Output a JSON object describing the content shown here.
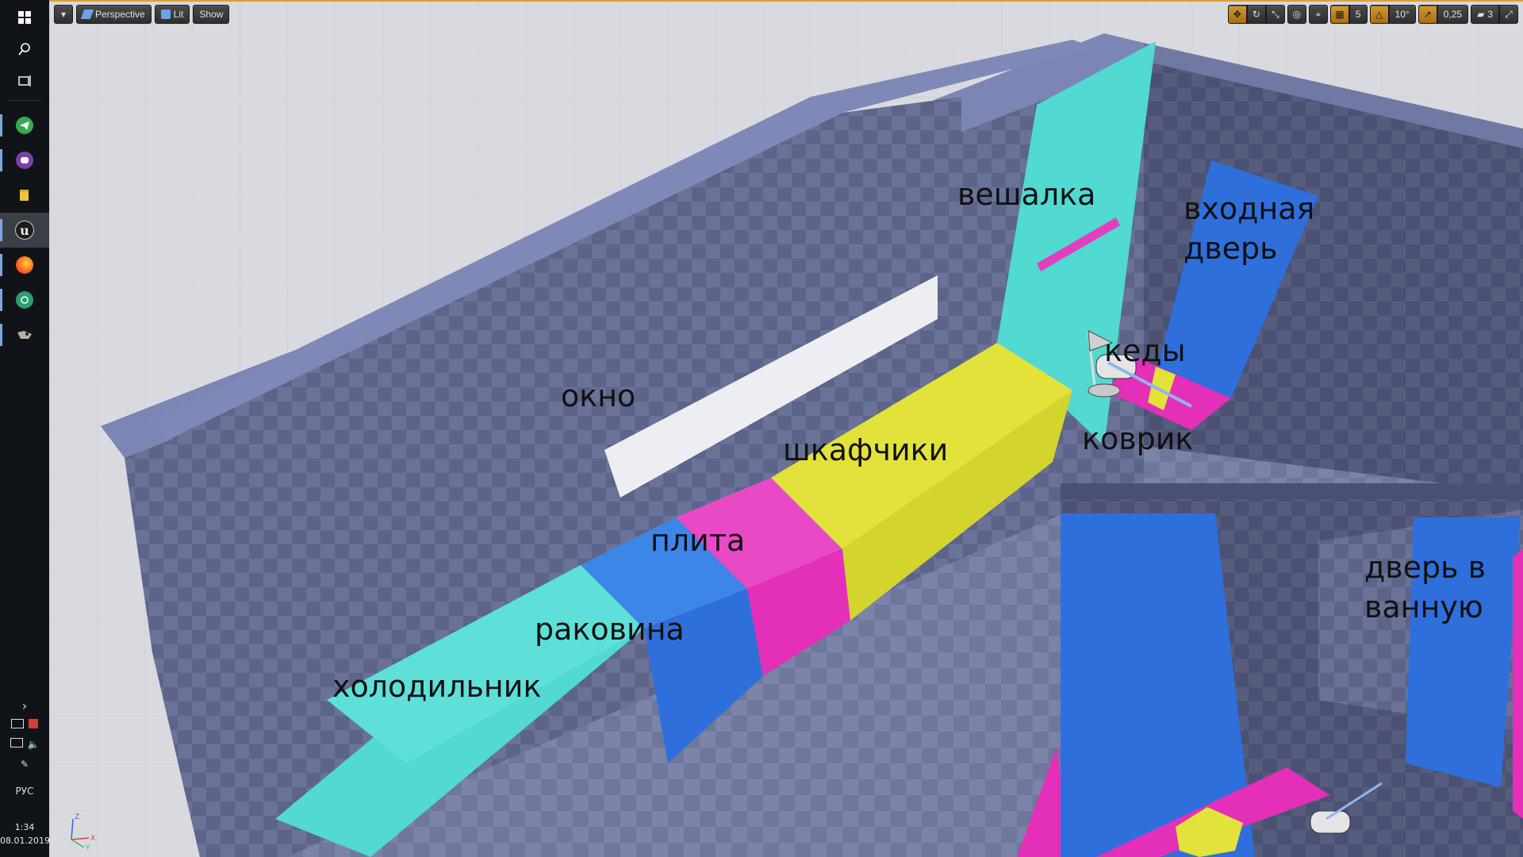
{
  "taskbar": {
    "apps": [
      {
        "name": "windows-start",
        "glyph": "⊞"
      },
      {
        "name": "search",
        "glyph": "⚲"
      },
      {
        "name": "task-view",
        "glyph": "▭"
      },
      {
        "name": "telegram",
        "glyph": "➤"
      },
      {
        "name": "app-purple",
        "glyph": "◉"
      },
      {
        "name": "file-explorer",
        "glyph": "▮"
      },
      {
        "name": "unreal-engine",
        "glyph": "u"
      },
      {
        "name": "firefox",
        "glyph": "●"
      },
      {
        "name": "app-green",
        "glyph": "✪"
      },
      {
        "name": "gimp",
        "glyph": "◣"
      }
    ],
    "tray_expand": "›",
    "language": "РУС",
    "time": "1:34",
    "date": "08.01.2019"
  },
  "viewport": {
    "menu_glyph": "▾",
    "perspective": "Perspective",
    "lit": "Lit",
    "show": "Show",
    "grid_snap": "5",
    "rotation_snap": "10°",
    "scale_snap": "0,25",
    "camera_speed": "3"
  },
  "labels": {
    "hanger": "вешалка",
    "front_door_1": "входная",
    "front_door_2": "дверь",
    "sneakers": "кеды",
    "window": "окно",
    "cabinets": "шкафчики",
    "mat": "коврик",
    "stove": "плита",
    "sink": "раковина",
    "fridge": "холодильник",
    "bath_door_1": "дверь в",
    "bath_door_2": "ванную"
  },
  "colors": {
    "accent": "#d8a23a",
    "cyan": "#52d9d1",
    "blue": "#2f6fdc",
    "magenta": "#e42fb8",
    "yellow": "#e2e23a"
  }
}
